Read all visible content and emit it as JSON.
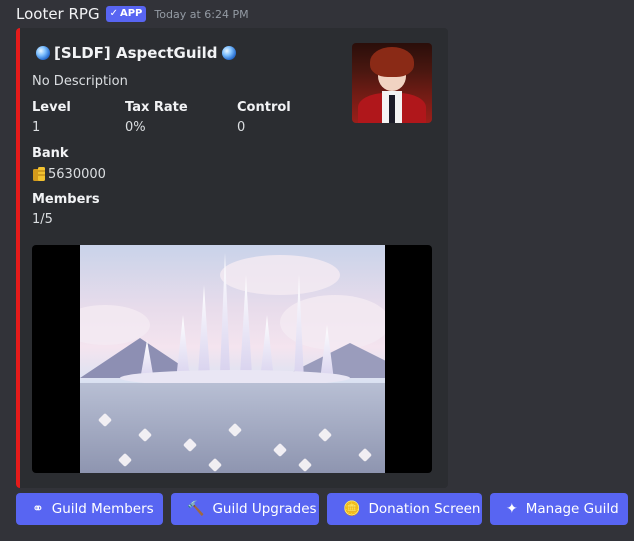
{
  "message": {
    "author": "Looter RPG",
    "badge": "APP",
    "badge_check": "✓",
    "timestamp": "Today at 6:24 PM"
  },
  "embed": {
    "accent_color": "#e41b1b",
    "title": "[SLDF] AspectGuild",
    "title_icon": "blue-orb-icon",
    "description": "No Description",
    "fields": [
      {
        "name": "Level",
        "value": "1"
      },
      {
        "name": "Tax Rate",
        "value": "0%"
      },
      {
        "name": "Control",
        "value": "0"
      },
      {
        "name": "Bank",
        "value": "5630000",
        "icon": "coin-stack-icon"
      },
      {
        "name": "Members",
        "value": "1/5"
      }
    ],
    "thumbnail": "guild-avatar",
    "image": "crystal-city-landscape"
  },
  "buttons": [
    {
      "label": "Guild Members",
      "icon": "⚭",
      "icon_name": "members-icon"
    },
    {
      "label": "Guild Upgrades",
      "icon": "🔨",
      "icon_name": "hammer-icon"
    },
    {
      "label": "Donation Screen",
      "icon": "🪙",
      "icon_name": "coins-icon"
    },
    {
      "label": "Manage Guild",
      "icon": "✦",
      "icon_name": "crystal-icon"
    }
  ],
  "colors": {
    "background": "#323339",
    "embed_bg": "#2b2d31",
    "button": "#5865f2",
    "badge": "#5865f2"
  }
}
